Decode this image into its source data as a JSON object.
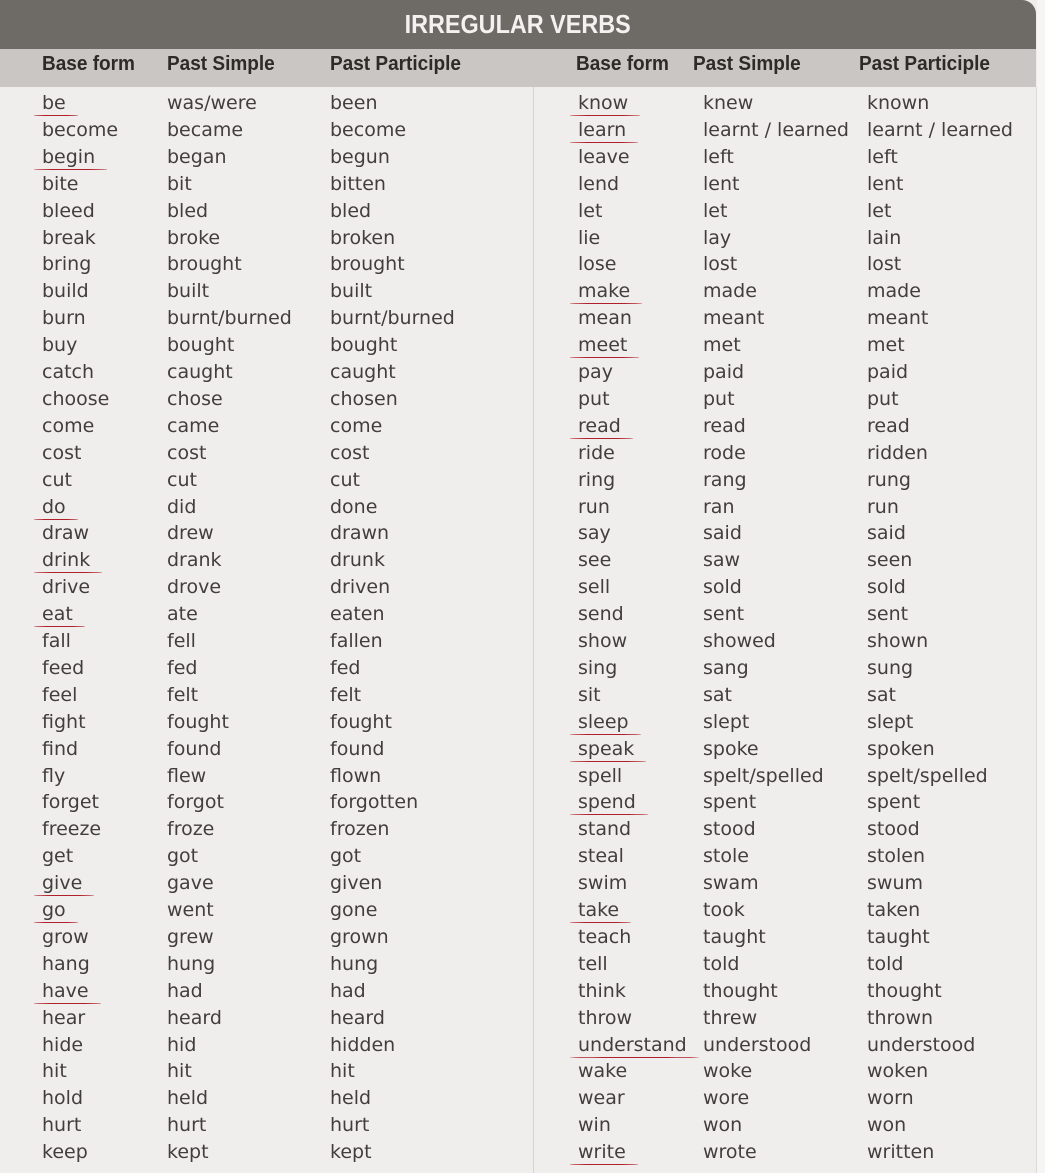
{
  "title": "IRREGULAR VERBS",
  "headers": {
    "left": [
      "Base form",
      "Past  Simple",
      "Past Participle"
    ],
    "right": [
      "Base form",
      "Past  Simple",
      "Past Participle"
    ]
  },
  "colors": {
    "title_bar": "#6e6a66",
    "header_row": "#c9c6c3",
    "underline": "#b0202a"
  },
  "left_verbs": [
    {
      "base": "be",
      "past": "was/were",
      "participle": "been",
      "underlined": true
    },
    {
      "base": "become",
      "past": "became",
      "participle": "become",
      "underlined": false
    },
    {
      "base": "begin",
      "past": "began",
      "participle": "begun",
      "underlined": true
    },
    {
      "base": "bite",
      "past": "bit",
      "participle": "bitten",
      "underlined": false
    },
    {
      "base": "bleed",
      "past": "bled",
      "participle": "bled",
      "underlined": false
    },
    {
      "base": "break",
      "past": "broke",
      "participle": "broken",
      "underlined": false
    },
    {
      "base": "bring",
      "past": "brought",
      "participle": "brought",
      "underlined": false
    },
    {
      "base": "build",
      "past": "built",
      "participle": "built",
      "underlined": false
    },
    {
      "base": "burn",
      "past": "burnt/burned",
      "participle": "burnt/burned",
      "underlined": false
    },
    {
      "base": "buy",
      "past": "bought",
      "participle": "bought",
      "underlined": false
    },
    {
      "base": "catch",
      "past": "caught",
      "participle": "caught",
      "underlined": false
    },
    {
      "base": "choose",
      "past": "chose",
      "participle": "chosen",
      "underlined": false
    },
    {
      "base": "come",
      "past": "came",
      "participle": "come",
      "underlined": false
    },
    {
      "base": "cost",
      "past": "cost",
      "participle": "cost",
      "underlined": false
    },
    {
      "base": "cut",
      "past": "cut",
      "participle": "cut",
      "underlined": false
    },
    {
      "base": "do",
      "past": "did",
      "participle": "done",
      "underlined": true
    },
    {
      "base": "draw",
      "past": "drew",
      "participle": "drawn",
      "underlined": false
    },
    {
      "base": "drink",
      "past": "drank",
      "participle": "drunk",
      "underlined": true
    },
    {
      "base": "drive",
      "past": "drove",
      "participle": "driven",
      "underlined": false
    },
    {
      "base": "eat",
      "past": "ate",
      "participle": "eaten",
      "underlined": true
    },
    {
      "base": "fall",
      "past": "fell",
      "participle": "fallen",
      "underlined": false
    },
    {
      "base": "feed",
      "past": "fed",
      "participle": "fed",
      "underlined": false
    },
    {
      "base": "feel",
      "past": "felt",
      "participle": "felt",
      "underlined": false
    },
    {
      "base": "fight",
      "past": "fought",
      "participle": "fought",
      "underlined": false
    },
    {
      "base": "find",
      "past": "found",
      "participle": "found",
      "underlined": false
    },
    {
      "base": "fly",
      "past": "flew",
      "participle": "flown",
      "underlined": false
    },
    {
      "base": "forget",
      "past": "forgot",
      "participle": "forgotten",
      "underlined": false
    },
    {
      "base": "freeze",
      "past": "froze",
      "participle": "frozen",
      "underlined": false
    },
    {
      "base": "get",
      "past": "got",
      "participle": "got",
      "underlined": false
    },
    {
      "base": "give",
      "past": "gave",
      "participle": "given",
      "underlined": true
    },
    {
      "base": "go",
      "past": "went",
      "participle": "gone",
      "underlined": true
    },
    {
      "base": "grow",
      "past": "grew",
      "participle": "grown",
      "underlined": false
    },
    {
      "base": "hang",
      "past": "hung",
      "participle": "hung",
      "underlined": false
    },
    {
      "base": "have",
      "past": "had",
      "participle": "had",
      "underlined": true
    },
    {
      "base": "hear",
      "past": "heard",
      "participle": "heard",
      "underlined": false
    },
    {
      "base": "hide",
      "past": "hid",
      "participle": "hidden",
      "underlined": false
    },
    {
      "base": "hit",
      "past": "hit",
      "participle": "hit",
      "underlined": false
    },
    {
      "base": "hold",
      "past": "held",
      "participle": "held",
      "underlined": false
    },
    {
      "base": "hurt",
      "past": "hurt",
      "participle": "hurt",
      "underlined": false
    },
    {
      "base": "keep",
      "past": "kept",
      "participle": "kept",
      "underlined": false
    }
  ],
  "right_verbs": [
    {
      "base": "know",
      "past": "knew",
      "participle": "known",
      "underlined": true
    },
    {
      "base": "learn",
      "past": "learnt / learned",
      "participle": "learnt / learned",
      "underlined": true
    },
    {
      "base": "leave",
      "past": "left",
      "participle": "left",
      "underlined": false
    },
    {
      "base": "lend",
      "past": "lent",
      "participle": "lent",
      "underlined": false
    },
    {
      "base": "let",
      "past": "let",
      "participle": "let",
      "underlined": false
    },
    {
      "base": "lie",
      "past": "lay",
      "participle": "lain",
      "underlined": false
    },
    {
      "base": "lose",
      "past": "lost",
      "participle": "lost",
      "underlined": false
    },
    {
      "base": "make",
      "past": "made",
      "participle": "made",
      "underlined": true
    },
    {
      "base": "mean",
      "past": "meant",
      "participle": "meant",
      "underlined": false
    },
    {
      "base": "meet",
      "past": "met",
      "participle": "met",
      "underlined": true
    },
    {
      "base": "pay",
      "past": "paid",
      "participle": "paid",
      "underlined": false
    },
    {
      "base": "put",
      "past": "put",
      "participle": "put",
      "underlined": false
    },
    {
      "base": "read",
      "past": "read",
      "participle": "read",
      "underlined": true
    },
    {
      "base": "ride",
      "past": "rode",
      "participle": "ridden",
      "underlined": false
    },
    {
      "base": "ring",
      "past": "rang",
      "participle": "rung",
      "underlined": false
    },
    {
      "base": "run",
      "past": "ran",
      "participle": "run",
      "underlined": false
    },
    {
      "base": "say",
      "past": "said",
      "participle": "said",
      "underlined": false
    },
    {
      "base": "see",
      "past": "saw",
      "participle": "seen",
      "underlined": false
    },
    {
      "base": "sell",
      "past": "sold",
      "participle": "sold",
      "underlined": false
    },
    {
      "base": "send",
      "past": "sent",
      "participle": "sent",
      "underlined": false
    },
    {
      "base": "show",
      "past": "showed",
      "participle": "shown",
      "underlined": false
    },
    {
      "base": "sing",
      "past": "sang",
      "participle": "sung",
      "underlined": false
    },
    {
      "base": "sit",
      "past": "sat",
      "participle": "sat",
      "underlined": false
    },
    {
      "base": "sleep",
      "past": "slept",
      "participle": "slept",
      "underlined": true
    },
    {
      "base": "speak",
      "past": "spoke",
      "participle": "spoken",
      "underlined": true
    },
    {
      "base": "spell",
      "past": "spelt/spelled",
      "participle": "spelt/spelled",
      "underlined": false
    },
    {
      "base": "spend",
      "past": "spent",
      "participle": "spent",
      "underlined": true
    },
    {
      "base": "stand",
      "past": "stood",
      "participle": "stood",
      "underlined": false
    },
    {
      "base": "steal",
      "past": "stole",
      "participle": "stolen",
      "underlined": false
    },
    {
      "base": "swim",
      "past": "swam",
      "participle": "swum",
      "underlined": false
    },
    {
      "base": "take",
      "past": "took",
      "participle": "taken",
      "underlined": true
    },
    {
      "base": "teach",
      "past": "taught",
      "participle": "taught",
      "underlined": false
    },
    {
      "base": "tell",
      "past": "told",
      "participle": "told",
      "underlined": false
    },
    {
      "base": "think",
      "past": "thought",
      "participle": "thought",
      "underlined": false
    },
    {
      "base": "throw",
      "past": "threw",
      "participle": "thrown",
      "underlined": false
    },
    {
      "base": "understand",
      "past": "understood",
      "participle": "understood",
      "underlined": true
    },
    {
      "base": "wake",
      "past": "woke",
      "participle": "woken",
      "underlined": false
    },
    {
      "base": "wear",
      "past": "wore",
      "participle": "worn",
      "underlined": false
    },
    {
      "base": "win",
      "past": "won",
      "participle": "won",
      "underlined": false
    },
    {
      "base": "write",
      "past": "wrote",
      "participle": "written",
      "underlined": true
    }
  ]
}
